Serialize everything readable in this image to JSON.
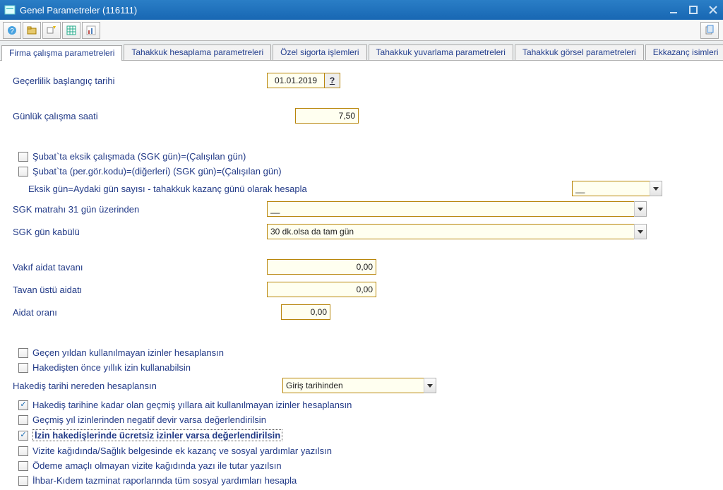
{
  "window": {
    "title": "Genel Parametreler (116111)"
  },
  "toolbar": {
    "icons": [
      "help-icon",
      "folder-icon",
      "search-spark-icon",
      "grid-icon",
      "chart-icon"
    ],
    "right_icon": "copy-icon"
  },
  "tabs": [
    {
      "label": "Firma çalışma parametreleri"
    },
    {
      "label": "Tahakkuk hesaplama parametreleri"
    },
    {
      "label": "Özel sigorta işlemleri"
    },
    {
      "label": "Tahakkuk yuvarlama parametreleri"
    },
    {
      "label": "Tahakkuk görsel parametreleri"
    },
    {
      "label": "Ekkazanç isimleri"
    }
  ],
  "fields": {
    "validity_label": "Geçerlilik başlangıç tarihi",
    "validity_value": "01.01.2019",
    "daily_hours_label": "Günlük çalışma saati",
    "daily_hours_value": "7,50",
    "feb_sgk_label": "Şubat`ta eksik çalışmada (SGK gün)=(Çalışılan gün)",
    "feb_per_label": "Şubat`ta (per.gör.kodu)=(diğerleri) (SGK gün)=(Çalışılan gün)",
    "eksik_gun_label": "Eksik gün=Aydaki gün sayısı - tahakkuk kazanç günü olarak hesapla",
    "eksik_gun_value": "__",
    "sgk_matrah_label": "SGK matrahı 31 gün üzerinden",
    "sgk_matrah_value": "__",
    "sgk_gun_label": "SGK gün kabülü",
    "sgk_gun_value": "30 dk.olsa da tam gün",
    "vakif_label": "Vakıf aidat tavanı",
    "vakif_value": "0,00",
    "tavan_label": "Tavan üstü aidatı",
    "tavan_value": "0,00",
    "aidat_label": "Aidat oranı",
    "aidat_value": "0,00",
    "izin1_label": "Geçen yıldan kullanılmayan izinler hesaplansın",
    "izin2_label": "Hakedişten önce yıllık izin kullanabilsin",
    "hakedis_label": "Hakediş tarihi nereden hesaplansın",
    "hakedis_value": "Giriş tarihinden",
    "izin3_label": "Hakediş tarihine kadar olan geçmiş yıllara ait kullanılmayan izinler hesaplansın",
    "izin4_label": "Geçmiş yıl izinlerinden negatif devir varsa değerlendirilsin",
    "izin5_label": "İzin hakedişlerinde ücretsiz izinler varsa değerlendirilsin",
    "vizite_label": "Vizite kağıdında/Sağlık belgesinde ek kazanç ve sosyal yardımlar yazılsın",
    "odeme_label": "Ödeme amaçlı olmayan vizite kağıdında yazı ile tutar yazılsın",
    "ihbar_label": "İhbar-Kıdem tazminat raporlarında tüm sosyal yardımları hesapla"
  }
}
